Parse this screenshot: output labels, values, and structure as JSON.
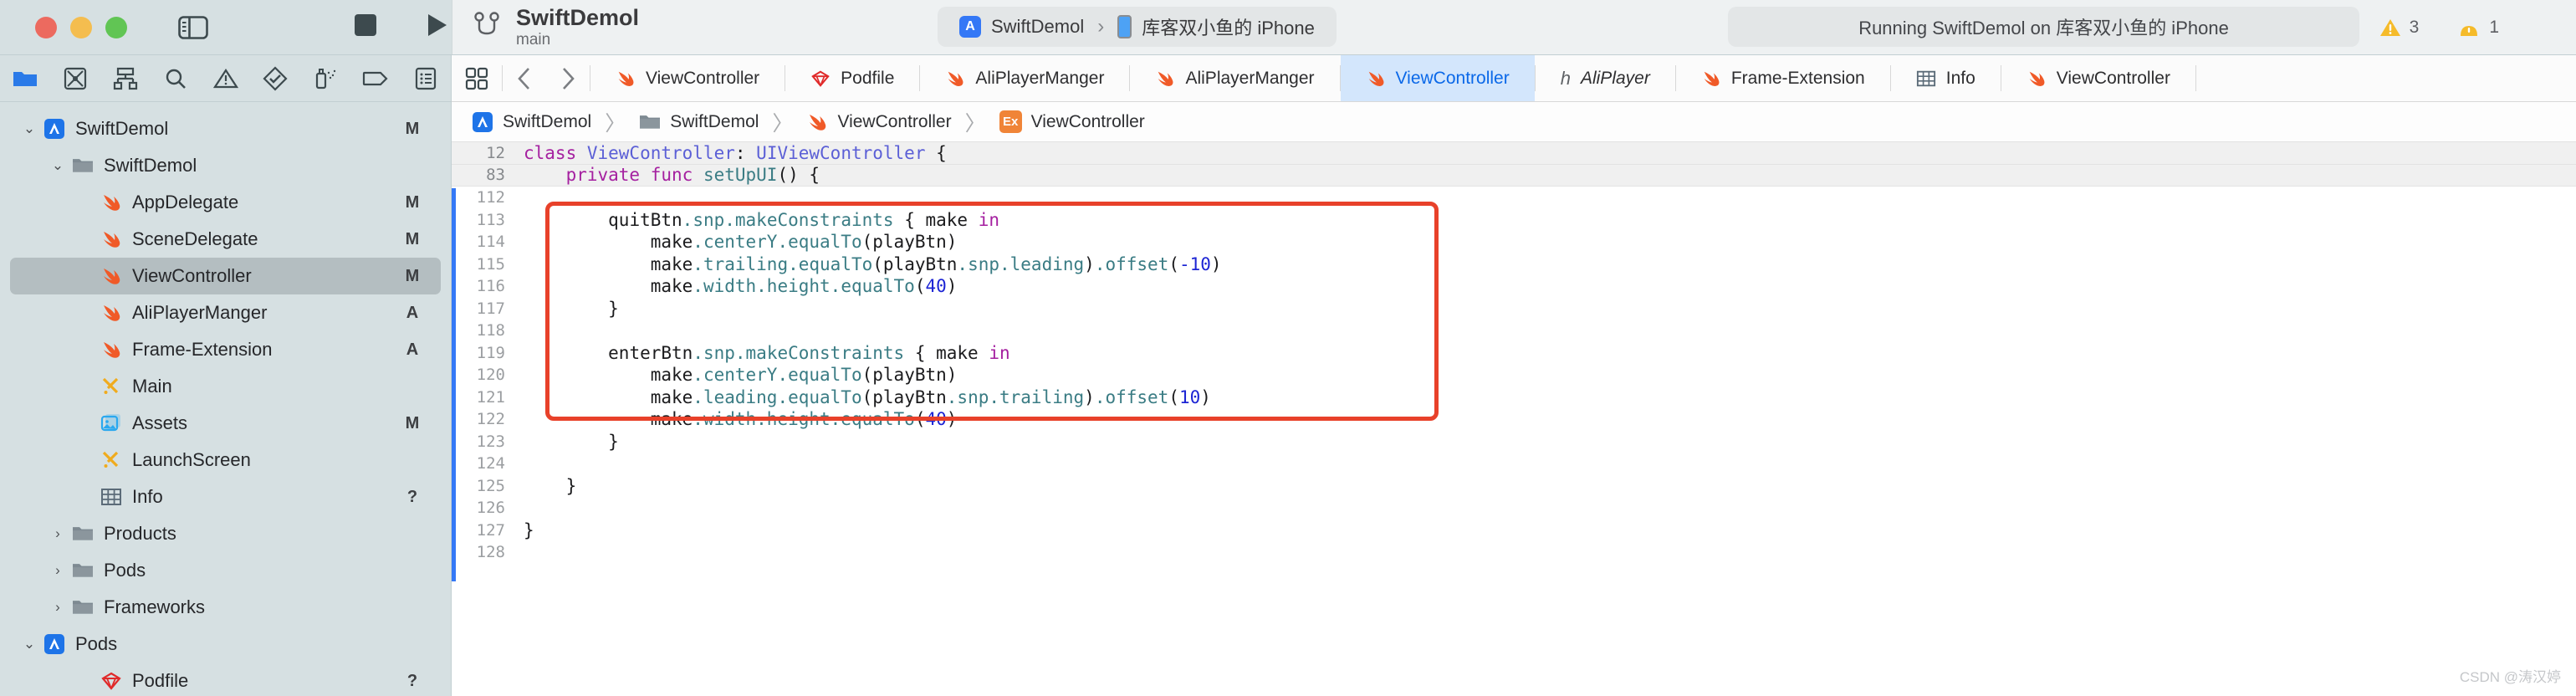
{
  "titlebar": {
    "project_title": "SwiftDemol",
    "branch": "main",
    "window_controls": [
      "close",
      "minimize",
      "zoom"
    ],
    "sidebar_toggle": "toggle-navigator",
    "stop_button": "stop",
    "run_button": "run",
    "scheme": {
      "scheme_name": "SwiftDemol",
      "separator": "›",
      "device_name": "库客双小鱼的 iPhone"
    },
    "status_text": "Running SwiftDemol on 库客双小鱼的 iPhone",
    "issues": [
      {
        "kind": "warning-triangle",
        "count": "3"
      },
      {
        "kind": "warning-badge",
        "count": "1"
      }
    ]
  },
  "navigator_toolbar": {
    "icons": [
      "folder-icon",
      "source-control-icon",
      "symbol-hierarchy-icon",
      "search-icon",
      "issue-warning-icon",
      "test-diamond-icon",
      "debug-spray-icon",
      "breakpoint-tag-icon",
      "report-list-icon"
    ]
  },
  "navigator": {
    "items": [
      {
        "label": "SwiftDemol",
        "icon": "app-project-icon",
        "status": "M",
        "depth": 0,
        "twisty": "⌄"
      },
      {
        "label": "SwiftDemol",
        "icon": "folder-icon",
        "status": "",
        "depth": 1,
        "twisty": "⌄"
      },
      {
        "label": "AppDelegate",
        "icon": "swift-icon",
        "status": "M",
        "depth": 2,
        "twisty": ""
      },
      {
        "label": "SceneDelegate",
        "icon": "swift-icon",
        "status": "M",
        "depth": 2,
        "twisty": ""
      },
      {
        "label": "ViewController",
        "icon": "swift-icon",
        "status": "M",
        "depth": 2,
        "twisty": "",
        "selected": true
      },
      {
        "label": "AliPlayerManger",
        "icon": "swift-icon",
        "status": "A",
        "depth": 2,
        "twisty": ""
      },
      {
        "label": "Frame-Extension",
        "icon": "swift-icon",
        "status": "A",
        "depth": 2,
        "twisty": ""
      },
      {
        "label": "Main",
        "icon": "storyboard-icon",
        "status": "",
        "depth": 2,
        "twisty": ""
      },
      {
        "label": "Assets",
        "icon": "assets-icon",
        "status": "M",
        "depth": 2,
        "twisty": ""
      },
      {
        "label": "LaunchScreen",
        "icon": "storyboard-icon",
        "status": "",
        "depth": 2,
        "twisty": ""
      },
      {
        "label": "Info",
        "icon": "plist-icon",
        "status": "?",
        "depth": 2,
        "twisty": ""
      },
      {
        "label": "Products",
        "icon": "folder-icon",
        "status": "",
        "depth": 1,
        "twisty": "›"
      },
      {
        "label": "Pods",
        "icon": "folder-icon",
        "status": "",
        "depth": 1,
        "twisty": "›"
      },
      {
        "label": "Frameworks",
        "icon": "folder-icon",
        "status": "",
        "depth": 1,
        "twisty": "›"
      },
      {
        "label": "Pods",
        "icon": "app-project-icon",
        "status": "",
        "depth": 0,
        "twisty": "⌄"
      },
      {
        "label": "Podfile",
        "icon": "ruby-icon",
        "status": "?",
        "depth": 2,
        "twisty": ""
      }
    ]
  },
  "tabbar": {
    "grid_icon": "editor-layout-icon",
    "back_icon": "chevron-left-icon",
    "forward_icon": "chevron-right-icon",
    "tabs": [
      {
        "label": "ViewController",
        "icon": "swift-icon",
        "active": false
      },
      {
        "label": "Podfile",
        "icon": "ruby-icon",
        "active": false
      },
      {
        "label": "AliPlayerManger",
        "icon": "swift-icon",
        "active": false
      },
      {
        "label": "AliPlayerManger",
        "icon": "swift-icon",
        "active": false
      },
      {
        "label": "ViewController",
        "icon": "swift-icon",
        "active": true
      },
      {
        "label": "AliPlayer",
        "icon": "header-icon",
        "active": false,
        "italic": true
      },
      {
        "label": "Frame-Extension",
        "icon": "swift-icon",
        "active": false
      },
      {
        "label": "Info",
        "icon": "plist-icon",
        "active": false
      },
      {
        "label": "ViewController",
        "icon": "swift-icon",
        "active": false
      }
    ]
  },
  "jumpbar": {
    "crumbs": [
      {
        "label": "SwiftDemol",
        "icon": "app-project-icon"
      },
      {
        "label": "SwiftDemol",
        "icon": "folder-icon"
      },
      {
        "label": "ViewController",
        "icon": "swift-icon"
      },
      {
        "label": "ViewController",
        "icon": "extension-ex-icon"
      }
    ],
    "separator": "〉"
  },
  "code": {
    "folded_lines": [
      {
        "no": "12",
        "indent": 0
      },
      {
        "no": "83",
        "indent": 1
      }
    ],
    "lines": [
      {
        "no": "112",
        "indent": 0
      },
      {
        "no": "113",
        "indent": 2
      },
      {
        "no": "114",
        "indent": 3
      },
      {
        "no": "115",
        "indent": 3
      },
      {
        "no": "116",
        "indent": 3
      },
      {
        "no": "117",
        "indent": 2
      },
      {
        "no": "118",
        "indent": 0
      },
      {
        "no": "119",
        "indent": 2
      },
      {
        "no": "120",
        "indent": 3
      },
      {
        "no": "121",
        "indent": 3
      },
      {
        "no": "122",
        "indent": 3
      },
      {
        "no": "123",
        "indent": 2
      },
      {
        "no": "124",
        "indent": 0
      },
      {
        "no": "125",
        "indent": 1
      },
      {
        "no": "126",
        "indent": 0
      },
      {
        "no": "127",
        "indent": 0
      },
      {
        "no": "128",
        "indent": 0
      }
    ]
  },
  "watermark": "CSDN @涛汉婷"
}
